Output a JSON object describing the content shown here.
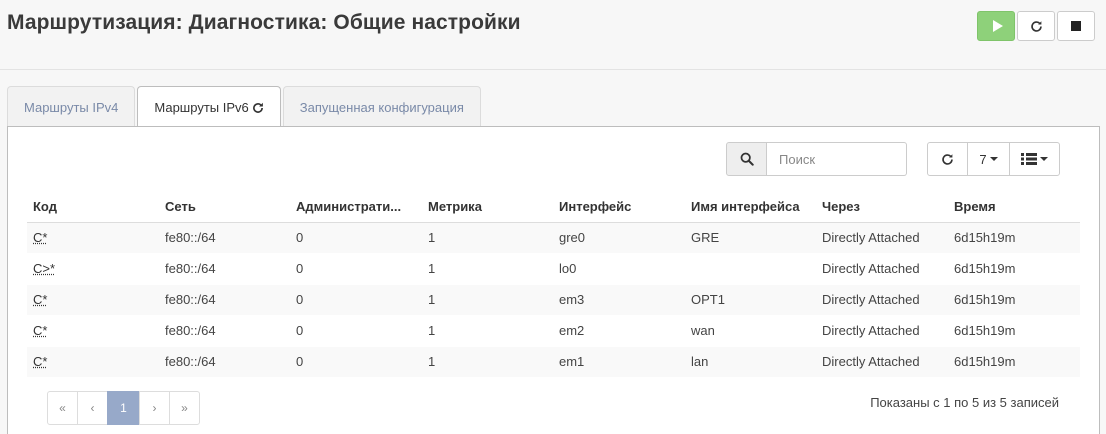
{
  "header": {
    "title": "Маршрутизация: Диагностика: Общие настройки",
    "buttons": [
      {
        "name": "play-icon"
      },
      {
        "name": "refresh-icon"
      },
      {
        "name": "stop-icon"
      }
    ]
  },
  "tabs": [
    {
      "label": "Маршруты IPv4",
      "active": false
    },
    {
      "label": "Маршруты IPv6",
      "active": true,
      "icon": "refresh-icon"
    },
    {
      "label": "Запущенная конфигурация",
      "active": false
    }
  ],
  "toolbar": {
    "search_placeholder": "Поиск",
    "rows_per_page": "7",
    "icons": [
      "search-icon",
      "refresh-icon",
      "columns-list-icon"
    ]
  },
  "table": {
    "columns": [
      "Код",
      "Сеть",
      "Администрати...",
      "Метрика",
      "Интерфейс",
      "Имя интерфейса",
      "Через",
      "Время"
    ],
    "rows": [
      [
        "C*",
        "fe80::/64",
        "0",
        "1",
        "gre0",
        "GRE",
        "Directly Attached",
        "6d15h19m"
      ],
      [
        "C>*",
        "fe80::/64",
        "0",
        "1",
        "lo0",
        "",
        "Directly Attached",
        "6d15h19m"
      ],
      [
        "C*",
        "fe80::/64",
        "0",
        "1",
        "em3",
        "OPT1",
        "Directly Attached",
        "6d15h19m"
      ],
      [
        "C*",
        "fe80::/64",
        "0",
        "1",
        "em2",
        "wan",
        "Directly Attached",
        "6d15h19m"
      ],
      [
        "C*",
        "fe80::/64",
        "0",
        "1",
        "em1",
        "lan",
        "Directly Attached",
        "6d15h19m"
      ]
    ]
  },
  "pagination": {
    "first": "«",
    "prev": "‹",
    "current": "1",
    "next": "›",
    "last": "»"
  },
  "footer": {
    "info": "Показаны с 1 по 5 из 5 записей"
  },
  "colors": {
    "play": "#8ed17a",
    "active_page": "#97a9c9",
    "tab_link": "#7a8aa8"
  }
}
